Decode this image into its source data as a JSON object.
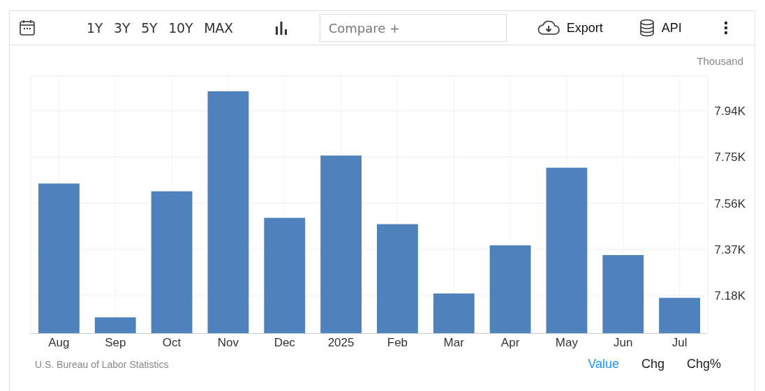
{
  "toolbar": {
    "ranges": [
      "1Y",
      "3Y",
      "5Y",
      "10Y",
      "MAX"
    ],
    "compare": {
      "placeholder": "Compare +"
    },
    "export": {
      "label": "Export"
    },
    "api": {
      "label": "API"
    }
  },
  "chart": {
    "unit": "Thousand",
    "chart_data": {
      "type": "bar",
      "categories": [
        "Aug",
        "Sep",
        "Oct",
        "Nov",
        "Dec",
        "2025",
        "Feb",
        "Mar",
        "Apr",
        "May",
        "Jun",
        "Jul"
      ],
      "grid": true,
      "series": [
        {
          "color": "#4f81bd",
          "values": [
            7.641,
            7.091,
            7.609,
            8.02,
            7.5,
            7.756,
            7.474,
            7.189,
            7.387,
            7.706,
            7.347,
            7.171
          ]
        }
      ],
      "ylim": [
        7.026,
        8.083
      ],
      "yticks": [
        {
          "value": 7.18,
          "label": "7.18K"
        },
        {
          "value": 7.37,
          "label": "7.37K"
        },
        {
          "value": 7.56,
          "label": "7.56K"
        },
        {
          "value": 7.75,
          "label": "7.75K"
        },
        {
          "value": 7.94,
          "label": "7.94K"
        }
      ]
    }
  },
  "footer": {
    "source": "U.S. Bureau of Labor Statistics",
    "tabs": [
      {
        "label": "Value",
        "selected": true
      },
      {
        "label": "Chg",
        "selected": false
      },
      {
        "label": "Chg%",
        "selected": false
      }
    ]
  }
}
